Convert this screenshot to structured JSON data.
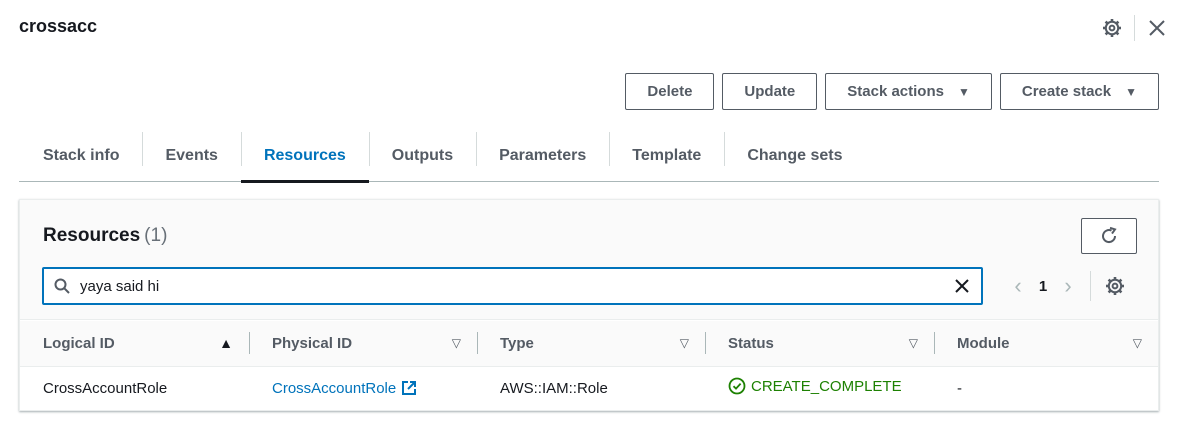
{
  "title": "crossacc",
  "top_icons": [
    "gear-icon",
    "close-icon"
  ],
  "actions": {
    "delete": "Delete",
    "update": "Update",
    "stack_actions": "Stack actions",
    "create_stack": "Create stack"
  },
  "tabs": [
    {
      "label": "Stack info",
      "active": false
    },
    {
      "label": "Events",
      "active": false
    },
    {
      "label": "Resources",
      "active": true
    },
    {
      "label": "Outputs",
      "active": false
    },
    {
      "label": "Parameters",
      "active": false
    },
    {
      "label": "Template",
      "active": false
    },
    {
      "label": "Change sets",
      "active": false
    }
  ],
  "resources": {
    "title": "Resources",
    "count": "(1)",
    "search_value": "yaya said hi",
    "page": "1",
    "columns": [
      "Logical ID",
      "Physical ID",
      "Type",
      "Status",
      "Module"
    ],
    "rows": [
      {
        "logical_id": "CrossAccountRole",
        "physical_id": "CrossAccountRole",
        "type": "AWS::IAM::Role",
        "status": "CREATE_COMPLETE",
        "module": "-"
      }
    ]
  },
  "colors": {
    "accent": "#0073bb",
    "success": "#1d8102",
    "text": "#16191f",
    "muted": "#545b64"
  }
}
